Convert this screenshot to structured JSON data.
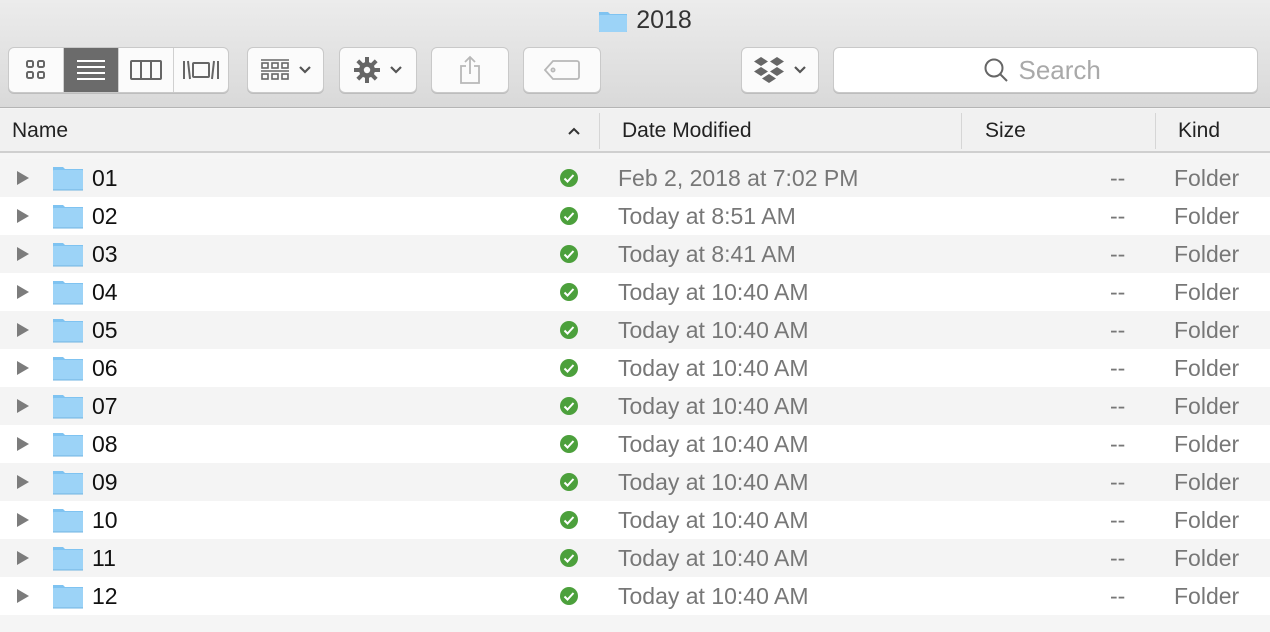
{
  "window": {
    "title": "2018",
    "title_icon": "folder-icon"
  },
  "toolbar": {
    "view_modes": [
      {
        "name": "icon-view",
        "icon": "grid-icon",
        "active": false
      },
      {
        "name": "list-view",
        "icon": "list-icon",
        "active": true
      },
      {
        "name": "column-view",
        "icon": "columns-icon",
        "active": false
      },
      {
        "name": "gallery-view",
        "icon": "cover-flow-icon",
        "active": false
      }
    ],
    "arrange_icon": "arrange-icon",
    "action_icon": "gear-icon",
    "share_icon": "share-icon",
    "tags_icon": "tag-icon",
    "dropbox_icon": "dropbox-icon",
    "search": {
      "placeholder": "Search",
      "value": ""
    }
  },
  "table": {
    "columns": {
      "name": "Name",
      "date_modified": "Date Modified",
      "size": "Size",
      "kind": "Kind"
    },
    "sort": {
      "column": "name",
      "direction": "ascending"
    },
    "rows": [
      {
        "name": "01",
        "status": "synced",
        "date": "Feb 2, 2018 at 7:02 PM",
        "size": "--",
        "kind": "Folder"
      },
      {
        "name": "02",
        "status": "synced",
        "date": "Today at 8:51 AM",
        "size": "--",
        "kind": "Folder"
      },
      {
        "name": "03",
        "status": "synced",
        "date": "Today at 8:41 AM",
        "size": "--",
        "kind": "Folder"
      },
      {
        "name": "04",
        "status": "synced",
        "date": "Today at 10:40 AM",
        "size": "--",
        "kind": "Folder"
      },
      {
        "name": "05",
        "status": "synced",
        "date": "Today at 10:40 AM",
        "size": "--",
        "kind": "Folder"
      },
      {
        "name": "06",
        "status": "synced",
        "date": "Today at 10:40 AM",
        "size": "--",
        "kind": "Folder"
      },
      {
        "name": "07",
        "status": "synced",
        "date": "Today at 10:40 AM",
        "size": "--",
        "kind": "Folder"
      },
      {
        "name": "08",
        "status": "synced",
        "date": "Today at 10:40 AM",
        "size": "--",
        "kind": "Folder"
      },
      {
        "name": "09",
        "status": "synced",
        "date": "Today at 10:40 AM",
        "size": "--",
        "kind": "Folder"
      },
      {
        "name": "10",
        "status": "synced",
        "date": "Today at 10:40 AM",
        "size": "--",
        "kind": "Folder"
      },
      {
        "name": "11",
        "status": "synced",
        "date": "Today at 10:40 AM",
        "size": "--",
        "kind": "Folder"
      },
      {
        "name": "12",
        "status": "synced",
        "date": "Today at 10:40 AM",
        "size": "--",
        "kind": "Folder"
      }
    ]
  },
  "colors": {
    "folder": "#8ecdf5",
    "synced": "#4ca03c",
    "active_view": "#6b6b6b"
  }
}
